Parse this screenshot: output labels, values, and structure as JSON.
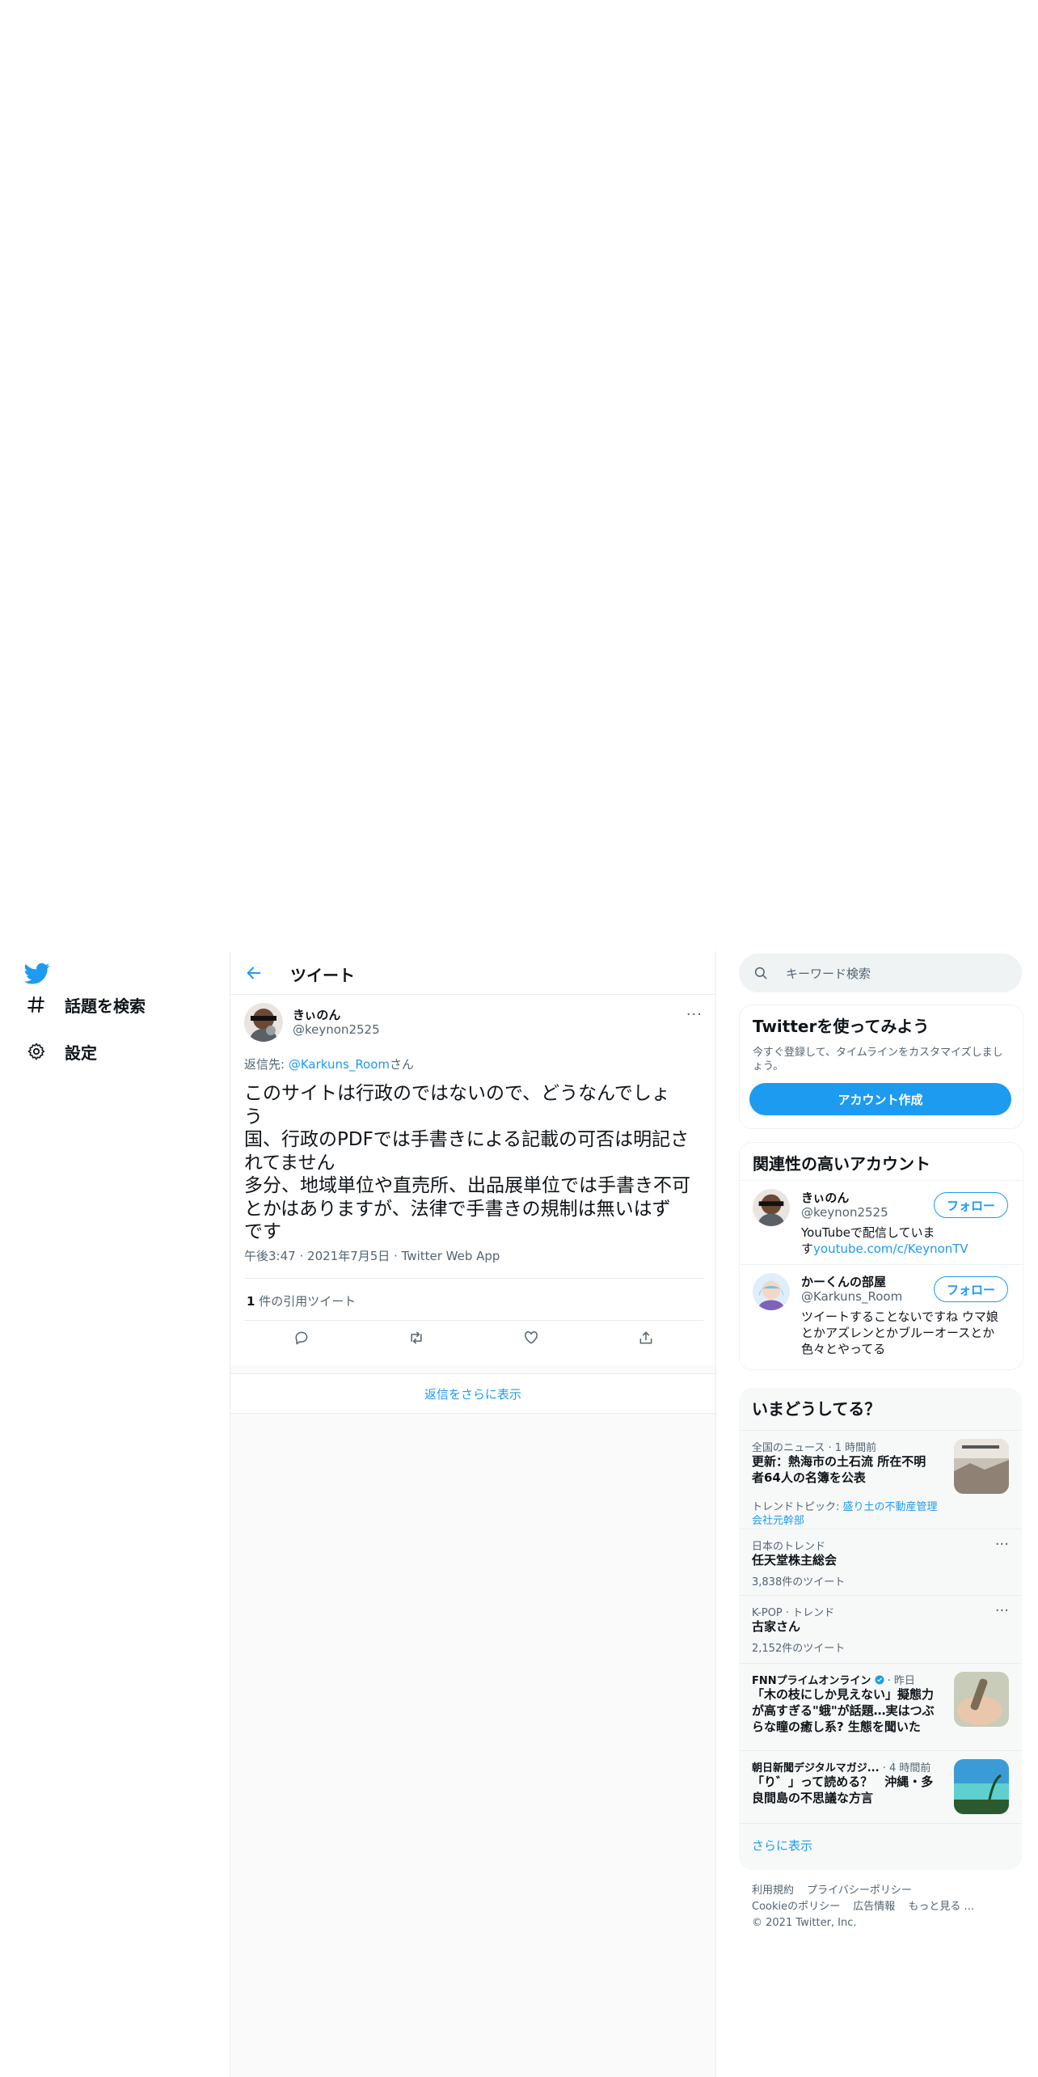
{
  "nav": {
    "explore": "話題を検索",
    "settings": "設定"
  },
  "header": {
    "title": "ツイート"
  },
  "tweet": {
    "display_name": "きぃのん",
    "username": "@keynon2525",
    "more": "···",
    "reply_prefix": "返信先: ",
    "reply_handle": "@Karkuns_Room",
    "reply_suffix": "さん",
    "lines": [
      "このサイトは行政のではないので、どうなんでしょ",
      "う",
      "国、行政のPDFでは手書きによる記載の可否は明記さ",
      "れてません",
      "多分、地域単位や直売所、出品展単位では手書き不可",
      "とかはありますが、法律で手書きの規制は無いはず",
      "です"
    ],
    "time": "午後3:47",
    "date": "2021年7月5日",
    "sep": "·",
    "source": "Twitter Web App",
    "quote_count": "1",
    "quote_label": " 件の引用ツイート"
  },
  "more_replies": "返信をさらに表示",
  "search": {
    "placeholder": "キーワード検索"
  },
  "signup": {
    "title": "Twitterを使ってみよう",
    "desc": "今すぐ登録して、タイムラインをカスタマイズしましょう。",
    "button": "アカウント作成"
  },
  "related": {
    "title": "関連性の高いアカウント",
    "follow": "フォロー",
    "accounts": [
      {
        "name": "きぃのん",
        "handle": "@keynon2525",
        "bio": "YouTubeで配信していま",
        "bio2": "す",
        "link": "youtube.com/c/KeynonTV"
      },
      {
        "name": "かーくんの部屋",
        "handle": "@Karkuns_Room",
        "bio": "ツイートすることないですね ウマ娘とかアズレンとかブルーオースとか色々とやってる"
      }
    ]
  },
  "trends": {
    "title": "いまどうしてる？",
    "items": [
      {
        "context": "全国のニュース · 1 時間前",
        "headline": "更新：熱海市の土石流 所在不明者64人の名簿を公表",
        "topic_prefix": "トレンドトピック: ",
        "topic": "盛り土の不動産管理会社元幹部"
      },
      {
        "context": "日本のトレンド",
        "headline": "任天堂株主総会",
        "count": "3,838件のツイート"
      },
      {
        "context": "K-POP · トレンド",
        "headline": "古家さん",
        "count": "2,152件のツイート"
      },
      {
        "context": "FNNプライムオンライン",
        "context2": " · 昨日",
        "headline": "「木の枝にしか見えない」擬態力が高すぎる\"蛾\"が話題…実はつぶらな瞳の癒し系? 生態を聞いた"
      },
      {
        "context": "朝日新聞デジタルマガジ...",
        "context2": " · 4 時間前",
        "headline": "「り゛」って読める？　沖縄・多良間島の不思議な方言"
      }
    ],
    "show_more": "さらに表示"
  },
  "footer": {
    "links": [
      "利用規約",
      "プライバシーポリシー",
      "Cookieのポリシー",
      "広告情報",
      "もっと見る ..."
    ],
    "copyright": "© 2021 Twitter, Inc."
  },
  "colors": {
    "accent": "#1d9bf0",
    "secondary_text": "#536471",
    "border": "#e6ecf0",
    "trend_bg": "#f7f9f9"
  },
  "icons": [
    "twitter-bird-icon",
    "hashtag-icon",
    "gear-icon",
    "back-arrow-icon",
    "search-icon",
    "reply-icon",
    "retweet-icon",
    "like-icon",
    "share-icon",
    "verified-icon"
  ]
}
